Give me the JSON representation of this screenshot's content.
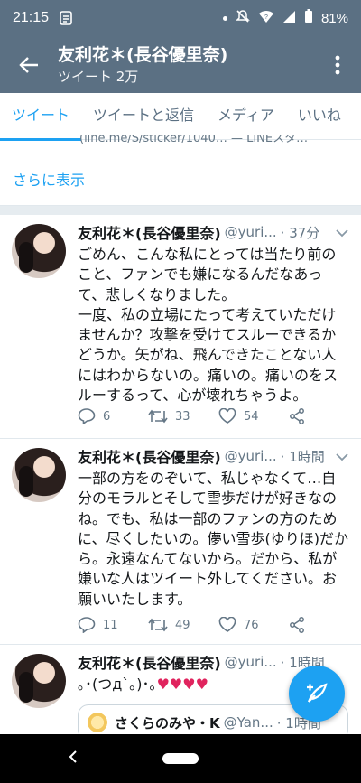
{
  "status_bar": {
    "time": "21:15",
    "battery": "81%"
  },
  "header": {
    "title": "友利花＊(長谷優里奈)",
    "subtitle": "ツイート 2万"
  },
  "tabs": [
    {
      "label": "ツイート"
    },
    {
      "label": "ツイートと返信"
    },
    {
      "label": "メディア"
    },
    {
      "label": "いいね"
    }
  ],
  "previous_tweet": {
    "cutoff_text": "(line.me/S/sticker/1040… — LINEスタ…",
    "show_more": "さらに表示"
  },
  "tweets": [
    {
      "name": "友利花＊(長谷優里奈)",
      "handle": "@yuri...",
      "time": "· 37分",
      "body": "ごめん、こんな私にとっては当たり前のこと、ファンでも嫌になるんだなあって、悲しくなりました。\n一度、私の立場にたって考えていただけませんか？攻撃を受けてスルーできるかどうか。矢がね、飛んできたことない人にはわからないの。痛いの。痛いのをスルーするって、心が壊れちゃうよ。",
      "replies": "6",
      "retweets": "33",
      "likes": "54"
    },
    {
      "name": "友利花＊(長谷優里奈)",
      "handle": "@yuri...",
      "time": "· 1時間",
      "body": "一部の方をのぞいて、私じゃなくて…自分のモラルとそして雪歩だけが好きなのね。でも、私は一部のファンの方のために、尽くしたいの。儚い雪歩(ゆりほ)だから。永遠なんてないから。だから、私が嫌いな人はツイート外してください。お願いいたします。",
      "replies": "11",
      "retweets": "49",
      "likes": "76"
    },
    {
      "name": "友利花＊(長谷優里奈)",
      "handle": "@yuri...",
      "time": "· 1時間",
      "body": "｡･(つд`｡)･｡♥♥♥♥",
      "quote": {
        "name": "さくらのみや・K",
        "handle": "@Yan...",
        "time": "· 1時間"
      }
    }
  ],
  "colors": {
    "header_bg": "#5b7083",
    "accent": "#1da1f2",
    "heart": "#e0245e"
  }
}
